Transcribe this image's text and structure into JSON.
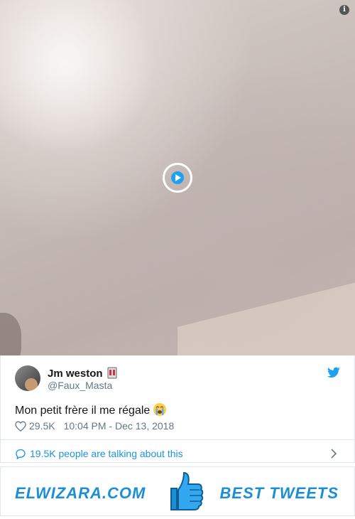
{
  "tweet": {
    "user_name": "Jm weston",
    "user_handle": "@Faux_Masta",
    "text": "Mon petit frère il me régale",
    "likes": "29.5K",
    "timestamp": "10:04 PM - Dec 13, 2018",
    "talking": "19.5K people are talking about this"
  },
  "banner": {
    "site": "ELWIZARA.COM",
    "tagline": "BEST TWEETS"
  },
  "icons": {
    "info": "info-icon",
    "play": "play-icon",
    "bird": "twitter-bird-icon",
    "heart": "heart-icon",
    "bubble": "speech-bubble-icon",
    "chevron": "chevron-right-icon",
    "thumb": "thumbs-up-icon"
  },
  "colors": {
    "accent": "#1b95e0",
    "text": "#14171a",
    "muted": "#657786",
    "banner_blue": "#1a8fd6"
  }
}
